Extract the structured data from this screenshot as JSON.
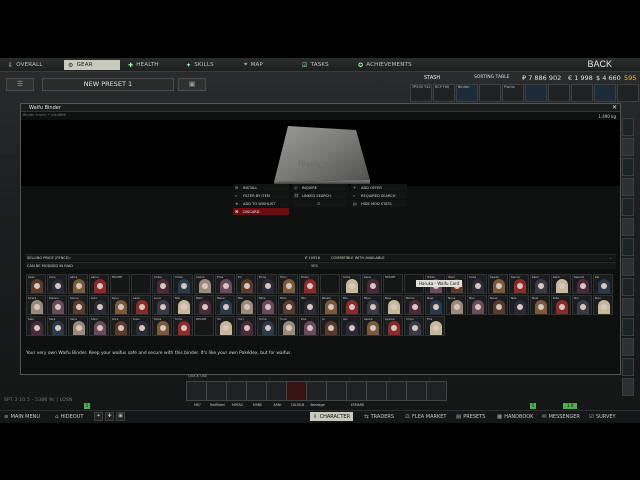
{
  "top_nav": {
    "tabs": [
      {
        "label": "OVERALL",
        "icon": "download-icon"
      },
      {
        "label": "GEAR",
        "icon": "gear-icon",
        "active": true
      },
      {
        "label": "HEALTH",
        "icon": "health-icon"
      },
      {
        "label": "SKILLS",
        "icon": "skills-icon"
      },
      {
        "label": "MAP",
        "icon": "map-pin-icon"
      },
      {
        "label": "TASKS",
        "icon": "tasks-icon"
      },
      {
        "label": "ACHIEVEMENTS",
        "icon": "achievements-icon"
      }
    ],
    "back_label": "BACK"
  },
  "preset": {
    "name": "NEW PRESET 1",
    "left_icon": "☰",
    "right_icon": "▣"
  },
  "stash": {
    "label": "STASH",
    "sorting_label": "SORTING TABLE",
    "roubles": "₽ 7 886 902",
    "euros": "€ 1 998",
    "dollars": "$ 4 660",
    "extra": "595",
    "strip": [
      "TP200 T42",
      "BCP FMJ",
      "Binder",
      "",
      "Plants",
      "",
      "",
      "",
      "",
      ""
    ]
  },
  "window": {
    "title": "Waifu Binder",
    "subtitle": "Binder Inmes • Vuk4666",
    "weight": "1.490 kg",
    "item_text": "Waifu Binder",
    "context_menu": [
      {
        "label": "INSTALL",
        "icon": "install-icon"
      },
      {
        "label": "INQUIRE",
        "icon": "inquire-icon"
      },
      {
        "label": "ADD OFFER",
        "icon": "add-offer-icon"
      },
      {
        "label": "FILTER BY ITEM",
        "icon": "filter-icon"
      },
      {
        "label": "LINKED SEARCH",
        "icon": "linked-search-icon"
      },
      {
        "label": "REQUIRED SEARCH",
        "icon": "required-search-icon"
      },
      {
        "label": "ADD TO WISHLIST",
        "icon": "wishlist-icon"
      },
      {
        "label": "",
        "icon": "lock-icon"
      },
      {
        "label": "HIDE MOD STATS",
        "icon": "hide-stats-icon"
      },
      {
        "label": "DISCARD",
        "icon": "discard-icon"
      }
    ],
    "info_rows": [
      {
        "left": "SELLING PRICE (FENCE):",
        "mid": "₽ 10928",
        "right": "COMPATIBLE WITH AVAILABLE"
      },
      {
        "left": "CAN BE MODDED IN RAID",
        "mid": "YES",
        "right": ""
      }
    ],
    "grid_labels": [
      "Akari",
      "Alice",
      "Akira",
      "Akino",
      "MOUNT",
      "",
      "Chika",
      "Chise",
      "Celica",
      "Ema",
      "Eri",
      "Erina",
      "Haru",
      "Hoshi",
      "",
      "Iroha",
      "Kana",
      "MOUNT",
      "",
      "Hikari",
      "Ibuki",
      "Iroha",
      "Kaede",
      "Kanna",
      "Kaori",
      "Karin",
      "Kasumi",
      "Kei",
      "Kirara",
      "Koharu",
      "Konoe",
      "Kuro",
      "Kyou",
      "Laila",
      "Luna",
      "Mai",
      "Maki",
      "Mana",
      "Mei",
      "Mika",
      "Miko",
      "Mio",
      "Misaki",
      "Miu",
      "Miyu",
      "Moe",
      "Momo",
      "Nagi",
      "Nana",
      "Nao",
      "Nene",
      "Noa",
      "Noel",
      "Rika",
      "Rin",
      "Ruri",
      "Saki",
      "Sara",
      "Sena",
      "Shiro",
      "Sora",
      "Suzu",
      "Tama",
      "Tomo",
      "MOUNT",
      "Yui",
      "Yuki",
      "Yume",
      "Yuna",
      "Zoe",
      "Ai",
      "Aoi",
      "Asuka",
      "Ayame",
      "Chiyo",
      "Emi"
    ],
    "tooltip": "Haruka - Waifu Card",
    "description": "Your very own Waifu Binder. Keep your waifus safe and secure with this binder. It's like your own Pokédex, but for waifus."
  },
  "quick_slots": {
    "label": "QUICK USE",
    "slots": [
      "M67",
      "RedRebel",
      "M9TAG",
      "M9BE",
      "AFAK",
      "CALOK-B",
      "Bandage",
      "",
      "ESMARK",
      "",
      "",
      "",
      ""
    ]
  },
  "version_text": "SPT 3.10.5 - 5386 9c | LOSN",
  "counters": {
    "left": "5",
    "right": "5",
    "right2": "1 0"
  },
  "bottom_nav": {
    "items": [
      {
        "label": "MAIN MENU",
        "icon": "menu-icon"
      },
      {
        "label": "HIDEOUT",
        "icon": "hideout-icon"
      },
      {
        "label": "CHARACTER",
        "icon": "character-icon",
        "active": true
      },
      {
        "label": "TRADERS",
        "icon": "traders-icon"
      },
      {
        "label": "FLEA MARKET",
        "icon": "flea-market-icon"
      },
      {
        "label": "PRESETS",
        "icon": "presets-icon"
      },
      {
        "label": "HANDBOOK",
        "icon": "handbook-icon"
      },
      {
        "label": "MESSENGER",
        "icon": "messenger-icon"
      },
      {
        "label": "SURVEY",
        "icon": "survey-icon"
      }
    ]
  },
  "colors": {
    "accent": "#c9c9bd",
    "discard": "#6a0e12",
    "status_green": "#4caf50"
  }
}
